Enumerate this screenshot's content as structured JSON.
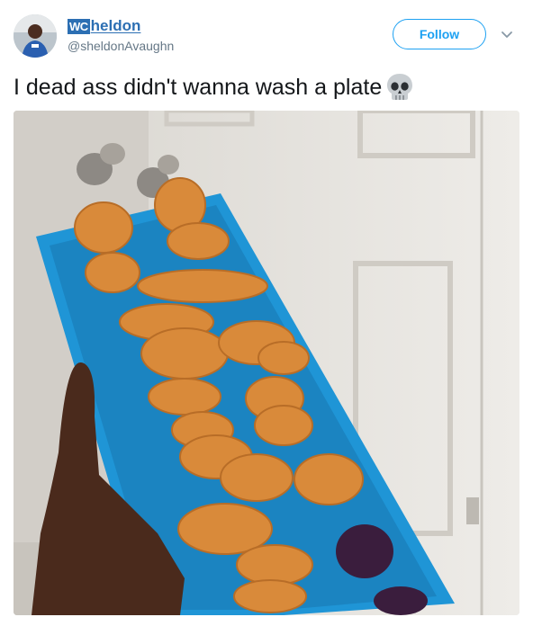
{
  "user": {
    "badge": "WC",
    "display_name": "heldon",
    "handle": "@sheldonAvaughn"
  },
  "actions": {
    "follow_label": "Follow"
  },
  "tweet": {
    "text": "I dead ass didn't wanna wash a plate",
    "emoji": "skull-emoji"
  },
  "media": {
    "description_icon": "photo",
    "colors": {
      "door": "#e6e3dd",
      "tray": "#1f95d6",
      "nugget": "#d98a3a",
      "sauce": "#3a1d3d",
      "skin": "#4a2a1c"
    }
  }
}
